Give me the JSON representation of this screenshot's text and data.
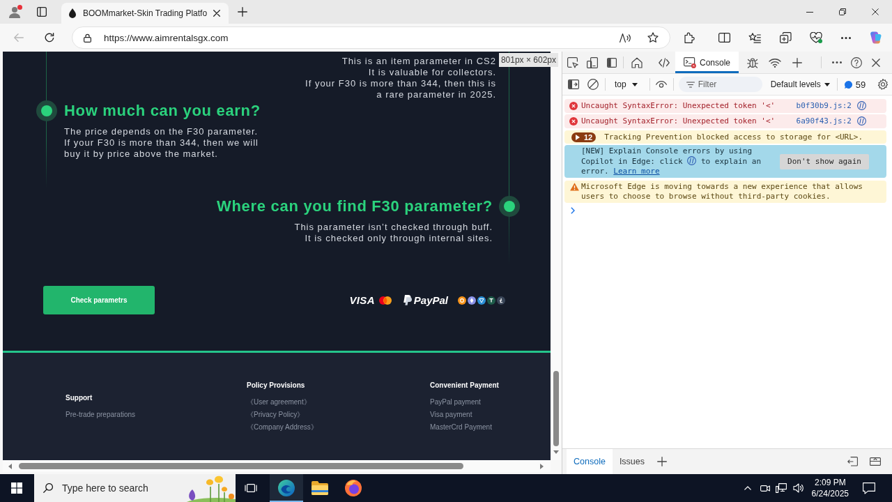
{
  "browser": {
    "tabs": [
      {
        "title": "BOOMmarket-Skin Trading Platfo",
        "selected": true
      }
    ],
    "nav_buttons": [
      {
        "kind": "back",
        "disabled": true
      },
      {
        "kind": "refresh",
        "disabled": false
      }
    ],
    "address_bar": {
      "url": "https://www.aimrentalsgx.com"
    }
  },
  "page": {
    "size_tooltip": "801px × 602px",
    "intro": "This is an item parameter in CS2\nIt is valuable for collectors.\nIf your F30 is more than 344, then this is\na rare parameter in 2025.",
    "steps": [
      {
        "kind": "left",
        "heading": "How much can you earn?",
        "text": "The price depends on the F30 parameter.\nIf your F30 is more than 344, then we will\nbuy it by price above the market."
      },
      {
        "kind": "right",
        "heading": "Where can you find F30 parameter?",
        "text": "This parameter isn’t checked through buff.\nIt is checked only through internal sites."
      }
    ],
    "button": "Check parametrs",
    "payment_logos": [
      {
        "kind": "visa",
        "label": "VISA"
      },
      {
        "kind": "mastercard"
      },
      {
        "kind": "paypal",
        "label": "PayPal"
      }
    ],
    "coins": [
      {
        "kind": "bitcoin",
        "color": "#f7931a"
      },
      {
        "kind": "ether",
        "color": "#8a92e8"
      },
      {
        "kind": "tron",
        "color": "#2b8fd6"
      },
      {
        "kind": "tether",
        "color": "#1d5b49"
      },
      {
        "kind": "litecoin",
        "color": "#3a4658"
      }
    ],
    "footer": {
      "columns": [
        {
          "heading": "Support",
          "links": [
            "Pre-trade preparations"
          ]
        },
        {
          "heading": "Policy Provisions",
          "links": [
            "《User agreement》",
            "《Privacy Policy》",
            "《Company Address》"
          ]
        },
        {
          "heading": "Convenient Payment",
          "links": [
            "PayPal payment",
            "Visa payment",
            "MasterCrd Payment"
          ]
        }
      ]
    }
  },
  "devtools": {
    "panel_tabs": [
      {
        "kind": "home",
        "selected": false
      },
      {
        "kind": "elements",
        "selected": false
      },
      {
        "kind": "console",
        "label": "Console",
        "selected": true
      },
      {
        "kind": "sources",
        "selected": false
      },
      {
        "kind": "network",
        "selected": false
      }
    ],
    "console_toolbar": {
      "context": "top",
      "filter": {
        "placeholder": "Filter"
      },
      "levels": "Default levels",
      "message_count": "59"
    },
    "messages": [
      {
        "kind": "error",
        "text": "Uncaught SyntaxError: Unexpected token '<'",
        "source": "b0f30b9.js:2"
      },
      {
        "kind": "error",
        "text": "Uncaught SyntaxError: Unexpected token '<'",
        "source": "6a90f43.js:2"
      },
      {
        "kind": "group",
        "count": "12",
        "expanded": false,
        "text": "Tracking Prevention blocked access to storage for <URL>."
      },
      {
        "kind": "banner",
        "text": "[NEW] Explain Console errors by using Copilot in Edge: click",
        "text_after": "to explain an error.",
        "link": "Learn more",
        "button": "Don't show again"
      },
      {
        "kind": "warning",
        "text": "Microsoft Edge is moving towards a new experience that allows users to choose to browse without third-party cookies."
      }
    ],
    "drawer_tabs": [
      {
        "label": "Console",
        "selected": true
      },
      {
        "label": "Issues",
        "selected": false
      }
    ]
  },
  "taskbar": {
    "search": {
      "placeholder": "Type here to search"
    },
    "apps": [
      {
        "kind": "edge",
        "selected": true
      },
      {
        "kind": "explorer",
        "selected": false
      },
      {
        "kind": "firefox",
        "selected": false
      }
    ],
    "clock": {
      "time": "2:09 PM",
      "date": "6/24/2025"
    }
  }
}
